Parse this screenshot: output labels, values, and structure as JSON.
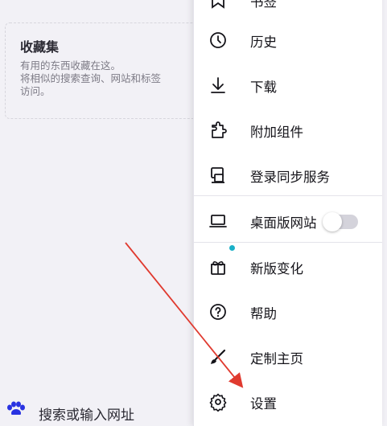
{
  "collections": {
    "title": "收藏集",
    "description": "有用的东西收藏在这。\n将相似的搜索查询、网站和标签\n访问。"
  },
  "search_bar": {
    "text": "搜索或输入网址"
  },
  "menu": {
    "items": [
      {
        "label": "书签",
        "icon": "bookmark-icon"
      },
      {
        "label": "历史",
        "icon": "history-icon"
      },
      {
        "label": "下载",
        "icon": "download-icon"
      },
      {
        "label": "附加组件",
        "icon": "addons-icon"
      },
      {
        "label": "登录同步服务",
        "icon": "sync-account-icon"
      },
      {
        "label": "桌面版网站",
        "icon": "desktop-icon",
        "toggle": false
      },
      {
        "label": "新版变化",
        "icon": "gift-icon",
        "badge": true
      },
      {
        "label": "帮助",
        "icon": "help-icon"
      },
      {
        "label": "定制主页",
        "icon": "brush-icon"
      },
      {
        "label": "设置",
        "icon": "gear-icon"
      }
    ]
  },
  "colors": {
    "badge": "#1ab0c8",
    "arrow": "#e03a2f"
  }
}
